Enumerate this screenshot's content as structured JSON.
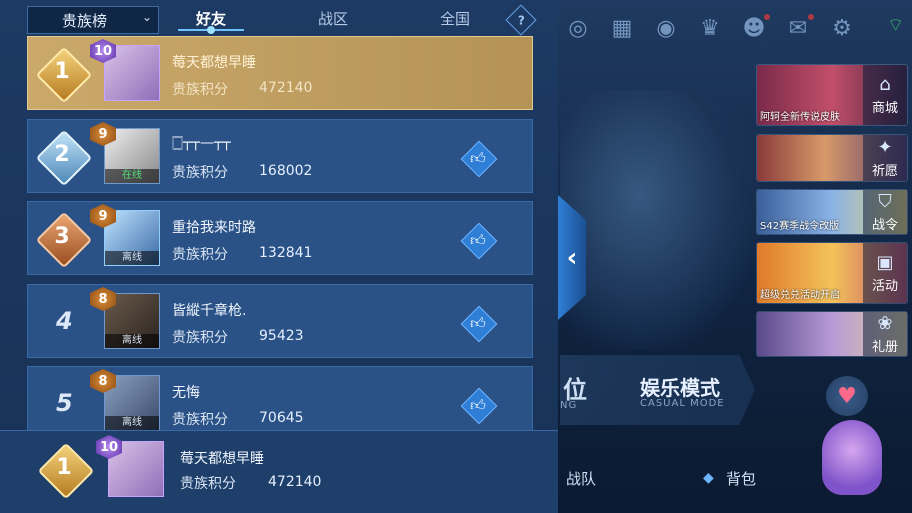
{
  "header": {
    "dropdown_label": "贵族榜",
    "tabs": [
      {
        "label": "好友",
        "active": true
      },
      {
        "label": "战区",
        "active": false
      },
      {
        "label": "全国",
        "active": false
      }
    ],
    "help_label": "?"
  },
  "score_label": "贵族积分",
  "status": {
    "online": "在线",
    "offline": "离线"
  },
  "rows": [
    {
      "rank": "1",
      "level": "10",
      "name": "莓天都想早睡",
      "score": "472140",
      "me": true
    },
    {
      "rank": "2",
      "level": "9",
      "name": "🀆┬┬—┬┬",
      "score": "168002",
      "status": "在线"
    },
    {
      "rank": "3",
      "level": "9",
      "name": "重拾我来时路",
      "score": "132841",
      "status": "离线"
    },
    {
      "rank": "4",
      "level": "8",
      "name": "皆縱千章枪.",
      "score": "95423",
      "status": "离线"
    },
    {
      "rank": "5",
      "level": "8",
      "name": "无悔",
      "score": "70645",
      "status": "离线"
    }
  ],
  "self_row": {
    "rank": "1",
    "level": "10",
    "name": "莓天都想早睡",
    "score": "472140"
  },
  "right": {
    "mode_left": "位",
    "mode_left_sub": "NG",
    "mode_title": "娱乐模式",
    "mode_sub": "CASUAL MODE",
    "team_label": "战队",
    "bag_label": "背包",
    "promos": [
      {
        "caption": "阿轲全新传说皮肤",
        "label": "商城",
        "icon": "shop-icon"
      },
      {
        "caption": "",
        "label": "祈愿",
        "icon": "wish-icon"
      },
      {
        "caption": "S42赛季战令改版",
        "label": "战令",
        "icon": "battlepass-icon"
      },
      {
        "caption": "超级兑兑活动开启",
        "label": "活动",
        "icon": "event-icon"
      },
      {
        "caption": "",
        "label": "礼册",
        "icon": "gift-book-icon"
      }
    ]
  },
  "colors": {
    "accent": "#2f7fd6",
    "gold": "#caa96b",
    "online": "#53e07d"
  }
}
